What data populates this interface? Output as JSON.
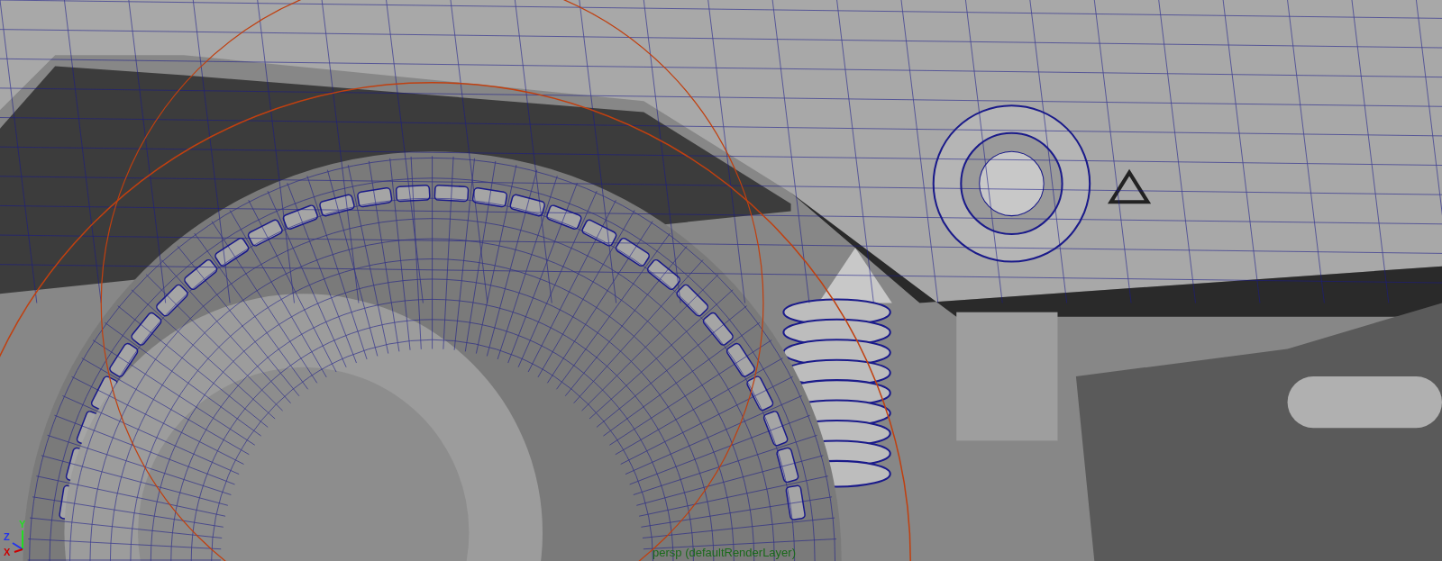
{
  "viewport": {
    "camera_label": "persp (defaultRenderLayer)",
    "axes": [
      {
        "label": "Y",
        "color": "#22dd22"
      },
      {
        "label": "Z",
        "color": "#2233ee"
      },
      {
        "label": "X",
        "color": "#cc0000"
      }
    ]
  }
}
